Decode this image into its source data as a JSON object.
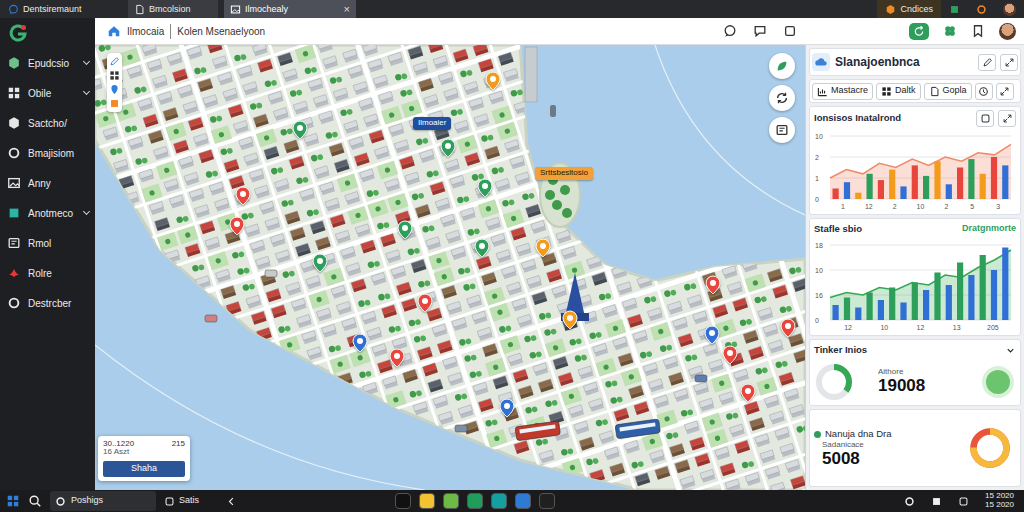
{
  "browser": {
    "app_name": "Dentsiremaunt",
    "tabs": [
      {
        "label": "Bmcolsion",
        "selected": false
      },
      {
        "label": "Ilmochealy",
        "selected": true
      }
    ],
    "close": "×",
    "account": "Cndices"
  },
  "sidebar": {
    "items": [
      {
        "label": "Epudcsio",
        "expandable": true,
        "color": "#6fbf8a"
      },
      {
        "label": "Obile",
        "expandable": true,
        "color": "#e6e6e6"
      },
      {
        "label": "Sactcho/",
        "expandable": false,
        "color": "#e6e6e6"
      },
      {
        "label": "Bmajisiom",
        "expandable": false,
        "color": "#e6e6e6"
      },
      {
        "label": "Anny",
        "expandable": false,
        "color": "#e6e6e6"
      },
      {
        "label": "Anotmeco",
        "expandable": true,
        "color": "#2bb3a3"
      },
      {
        "label": "Rmol",
        "expandable": false,
        "color": "#e6e6e6"
      },
      {
        "label": "Rolre",
        "expandable": false,
        "color": "#e53935"
      },
      {
        "label": "Destrcber",
        "expandable": false,
        "color": "#e6e6e6"
      }
    ]
  },
  "header": {
    "crumbs": [
      "Ilmocaia",
      "Kolen Msenaelyoon"
    ]
  },
  "map": {
    "labels": [
      {
        "text": "Ilmoaier",
        "color": "#1f4e9c"
      },
      {
        "text": "Srttsbesltosio",
        "color": "#f2a13a"
      }
    ],
    "pins": [
      {
        "color": "#e8453c"
      },
      {
        "color": "#e8453c"
      },
      {
        "color": "#2e9e5b"
      },
      {
        "color": "#f29b1d"
      },
      {
        "color": "#2e9e5b"
      },
      {
        "color": "#2e9e5b"
      },
      {
        "color": "#2e9e5b"
      },
      {
        "color": "#2e9e5b"
      },
      {
        "color": "#2e9e5b"
      },
      {
        "color": "#f29b1d"
      },
      {
        "color": "#e8453c"
      },
      {
        "color": "#f29b1d"
      },
      {
        "color": "#2f6fd6"
      },
      {
        "color": "#e8453c"
      },
      {
        "color": "#2f6fd6"
      },
      {
        "color": "#e8453c"
      },
      {
        "color": "#2f6fd6"
      },
      {
        "color": "#e8453c"
      },
      {
        "color": "#e8453c"
      },
      {
        "color": "#e8453c"
      }
    ],
    "info": {
      "coords": "30..1220",
      "count": "215",
      "date": "16 Aszt",
      "button": "Shaha"
    }
  },
  "panel": {
    "title": "Slanajoenbnca",
    "toolbar": [
      "Mastacre",
      "Daltk",
      "Gopla"
    ],
    "chart1": {
      "title": "Ionsisos Inatalrond",
      "y_ticks": [
        "10",
        "2",
        "1",
        "0"
      ],
      "x_ticks": [
        "1",
        "12",
        "2",
        "10",
        "2",
        "5",
        "3"
      ],
      "area": [
        1.0,
        1.4,
        1.2,
        1.7,
        1.5,
        1.9,
        1.6,
        2.0,
        1.8,
        2.2,
        2.1,
        2.6
      ],
      "bars": [
        {
          "value": 0.5,
          "color": "#e8453c"
        },
        {
          "value": 0.8,
          "color": "#2f6fd6"
        },
        {
          "value": 0.3,
          "color": "#f29b1d"
        },
        {
          "value": 1.2,
          "color": "#2e9e5b"
        },
        {
          "value": 0.9,
          "color": "#e8453c"
        },
        {
          "value": 1.4,
          "color": "#f29b1d"
        },
        {
          "value": 0.6,
          "color": "#2f6fd6"
        },
        {
          "value": 1.6,
          "color": "#e8453c"
        },
        {
          "value": 1.1,
          "color": "#2e9e5b"
        },
        {
          "value": 1.8,
          "color": "#f29b1d"
        },
        {
          "value": 0.7,
          "color": "#2f6fd6"
        },
        {
          "value": 1.5,
          "color": "#e8453c"
        },
        {
          "value": 1.9,
          "color": "#2e9e5b"
        },
        {
          "value": 1.2,
          "color": "#f29b1d"
        },
        {
          "value": 2.0,
          "color": "#e8453c"
        },
        {
          "value": 1.6,
          "color": "#2f6fd6"
        }
      ]
    },
    "chart2": {
      "title": "Stafle sbio",
      "legend": "Dratgnmorte",
      "y_ticks": [
        "18",
        "10",
        "16",
        "0"
      ],
      "x_ticks": [
        "12",
        "10",
        "12",
        "13",
        "205"
      ],
      "area": [
        0.9,
        1.1,
        1.0,
        1.3,
        1.2,
        1.5,
        1.4,
        1.8,
        1.7,
        2.1,
        2.4,
        2.8
      ],
      "bars": [
        {
          "value": 0.6,
          "color": "#2f6fd6"
        },
        {
          "value": 0.9,
          "color": "#2e9e5b"
        },
        {
          "value": 0.5,
          "color": "#2f6fd6"
        },
        {
          "value": 1.1,
          "color": "#2e9e5b"
        },
        {
          "value": 0.8,
          "color": "#2f6fd6"
        },
        {
          "value": 1.3,
          "color": "#2e9e5b"
        },
        {
          "value": 0.7,
          "color": "#2f6fd6"
        },
        {
          "value": 1.5,
          "color": "#2e9e5b"
        },
        {
          "value": 1.2,
          "color": "#2f6fd6"
        },
        {
          "value": 1.9,
          "color": "#2e9e5b"
        },
        {
          "value": 1.4,
          "color": "#2f6fd6"
        },
        {
          "value": 2.3,
          "color": "#2e9e5b"
        },
        {
          "value": 1.8,
          "color": "#2f6fd6"
        },
        {
          "value": 2.6,
          "color": "#2e9e5b"
        },
        {
          "value": 2.0,
          "color": "#2f6fd6"
        },
        {
          "value": 2.9,
          "color": "#2f6fd6"
        }
      ]
    },
    "stat1": {
      "title": "Tinker Inios",
      "expanded": true,
      "label": "Aithore",
      "value": "19008",
      "level": 0.35
    },
    "stat2": {
      "title": "Nanuja dna Dra",
      "subtitle": "Sadanicace",
      "value": "5008",
      "level": 0.75
    }
  },
  "taskbar": {
    "search": "Poshigs",
    "app": "Satis",
    "clock": [
      "15 2020",
      "15 2020"
    ]
  }
}
